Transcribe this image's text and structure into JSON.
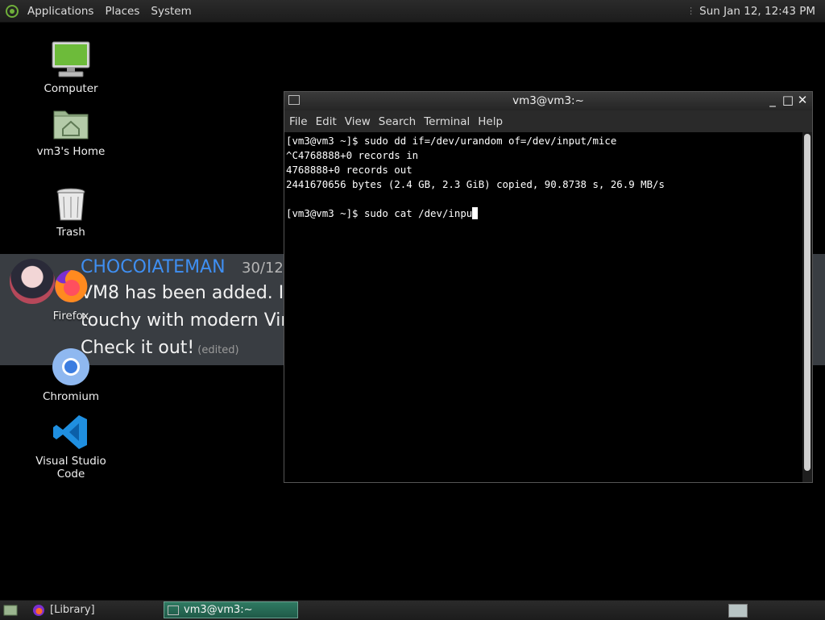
{
  "top_panel": {
    "menus": [
      "Applications",
      "Places",
      "System"
    ],
    "clock": "Sun Jan 12, 12:43 PM"
  },
  "desktop": {
    "icons": [
      {
        "label": "Computer",
        "icon": "computer-icon"
      },
      {
        "label": "vm3's Home",
        "icon": "home-folder-icon"
      },
      {
        "label": "Trash",
        "icon": "trash-icon"
      },
      {
        "label": "Firefox",
        "icon": "firefox-icon"
      },
      {
        "label": "Chromium",
        "icon": "chromium-icon"
      },
      {
        "label": "Visual Studio Code",
        "icon": "vscode-icon"
      }
    ]
  },
  "banner": {
    "author": "CHOCOIATEMAN",
    "date": "30/12/",
    "lines": [
      "VM8 has been added. It i",
      "touchy with modern Virti",
      "Check it out!"
    ],
    "edited": "(edited)"
  },
  "terminal": {
    "title": "vm3@vm3:~",
    "menu": [
      "File",
      "Edit",
      "View",
      "Search",
      "Terminal",
      "Help"
    ],
    "lines": [
      "[vm3@vm3 ~]$ sudo dd if=/dev/urandom of=/dev/input/mice",
      "^C4768888+0 records in",
      "4768888+0 records out",
      "2441670656 bytes (2.4 GB, 2.3 GiB) copied, 90.8738 s, 26.9 MB/s",
      "",
      "[vm3@vm3 ~]$ sudo cat /dev/inpu"
    ]
  },
  "taskbar": {
    "tasks": [
      "[Library]",
      "vm3@vm3:~"
    ]
  },
  "colors": {
    "panel": "#1f1f1f",
    "active_task": "#2f7a62",
    "author": "#3f8ff2"
  }
}
